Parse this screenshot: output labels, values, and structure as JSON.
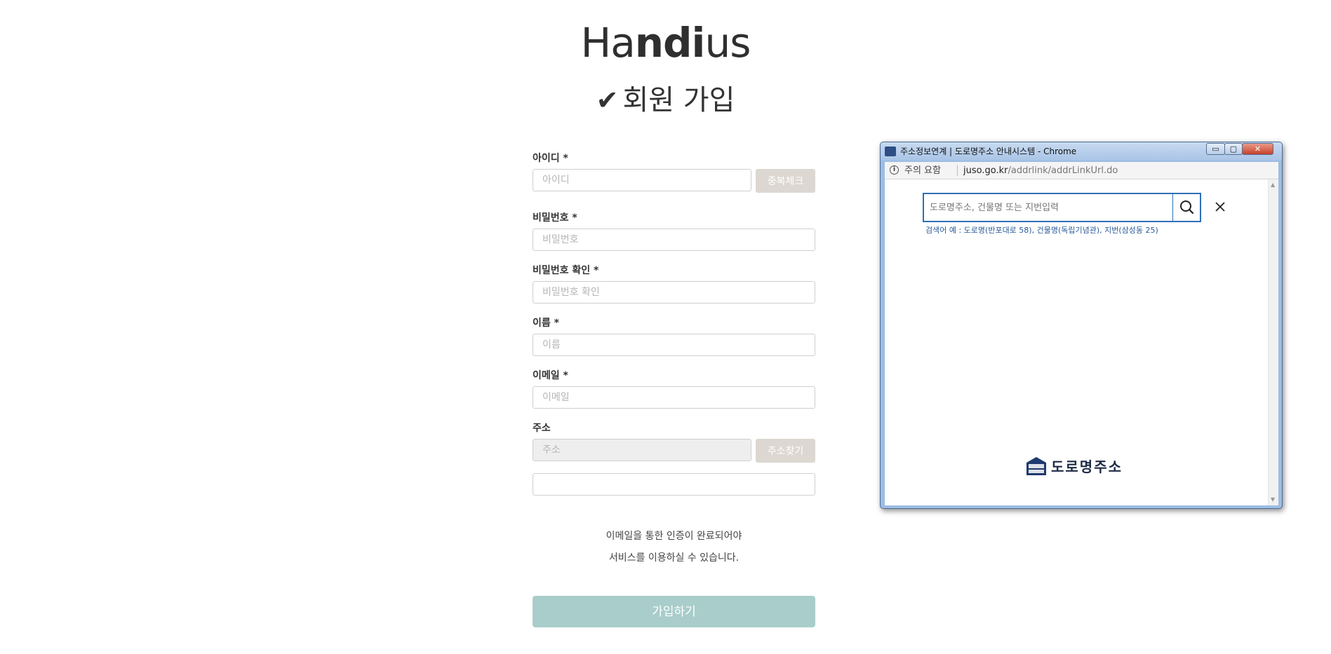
{
  "brand": {
    "logo_prefix": "Ha",
    "logo_mid_bold": "nd",
    "logo_i": "i",
    "logo_suffix": "us",
    "check_glyph": "✔",
    "page_title": "회원 가입"
  },
  "form": {
    "id": {
      "label": "아이디 *",
      "placeholder": "아이디",
      "button": "중복체크"
    },
    "password": {
      "label": "비밀번호 *",
      "placeholder": "비밀번호"
    },
    "password_confirm": {
      "label": "비밀번호 확인 *",
      "placeholder": "비밀번호 확인"
    },
    "name": {
      "label": "이름 *",
      "placeholder": "이름"
    },
    "email": {
      "label": "이메일 *",
      "placeholder": "이메일"
    },
    "address": {
      "label": "주소",
      "placeholder": "주소",
      "button": "주소찾기",
      "detail_value": ""
    },
    "notice_line1": "이메일을 통한 인증이 완료되어야",
    "notice_line2": "서비스를 이용하실 수 있습니다.",
    "submit_label": "가입하기"
  },
  "popup": {
    "window_title": "주소정보연계 | 도로명주소 안내시스템 - Chrome",
    "window_buttons": {
      "minimize": "▭",
      "maximize": "▢",
      "close": "✕"
    },
    "address_bar": {
      "warning": "주의 요함",
      "domain": "juso.go.kr",
      "path": "/addrlink/addrLinkUrl.do"
    },
    "search": {
      "placeholder": "도로명주소, 건물명 또는 지번입력",
      "hint": "검색어 예 : 도로명(반포대로 58), 건물명(독립기념관), 지번(삼성동 25)"
    },
    "footer_logo_text": "도로명주소",
    "colors": {
      "search_border": "#2e6fb9",
      "hint_text": "#2a5a9a",
      "logo_navy": "#1d2a45"
    }
  },
  "icons": {
    "check": "check-icon",
    "info": "info-icon",
    "search": "search-icon",
    "close": "close-icon",
    "logo_mark": "juso-logo-icon"
  },
  "colors": {
    "submit_button": "#a9cdcb",
    "side_button": "#dcd7d1",
    "disabled_input": "#eeeeee"
  }
}
